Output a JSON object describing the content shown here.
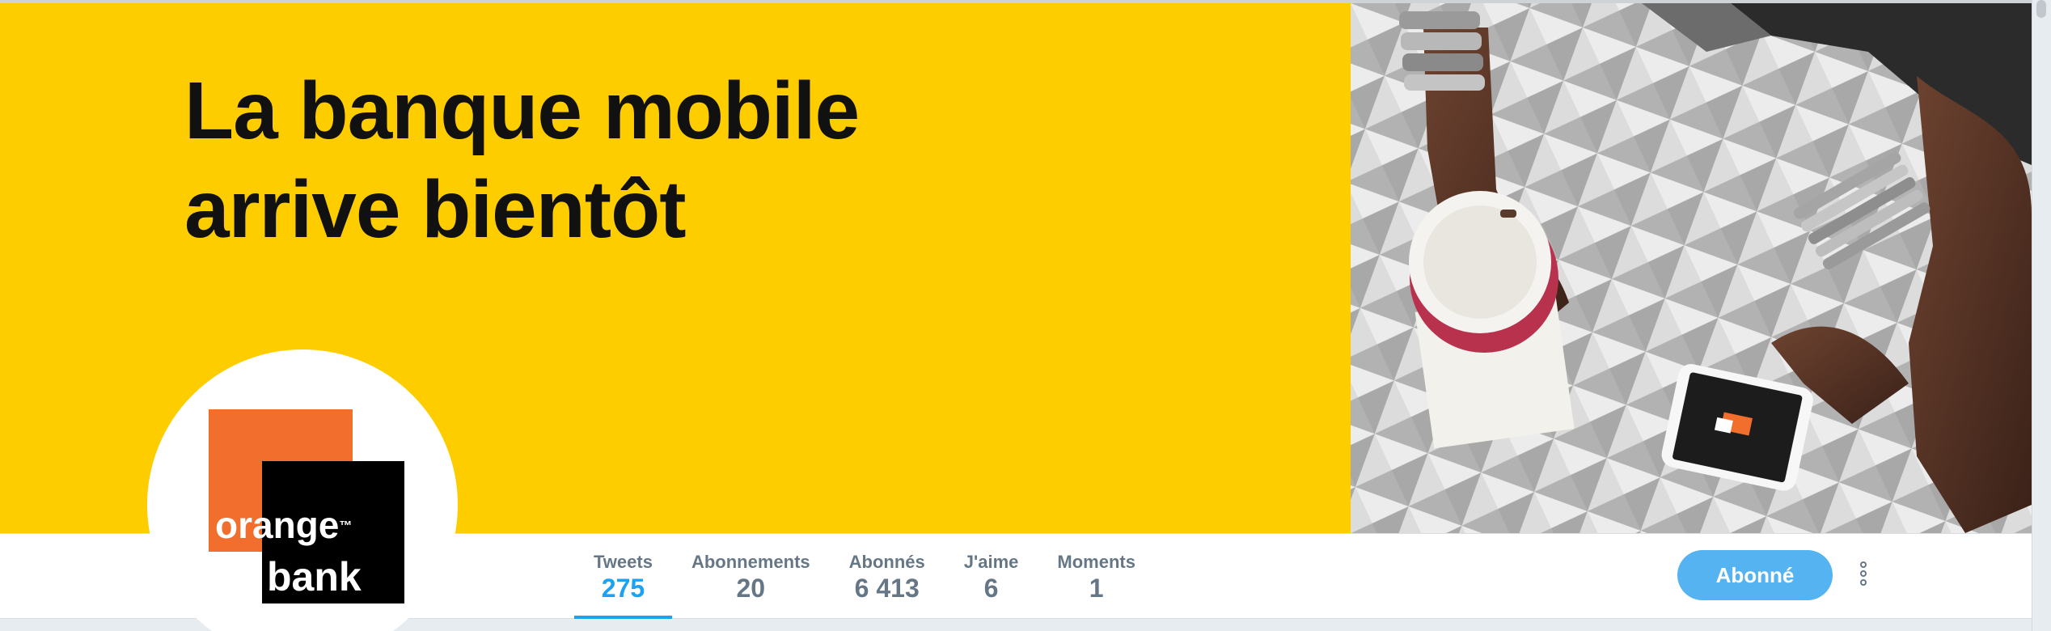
{
  "banner": {
    "headline_line1": "La banque mobile",
    "headline_line2": "arrive bientôt",
    "background_color": "#fecd00"
  },
  "avatar": {
    "logo_word_orange": "orange",
    "logo_tm": "™",
    "logo_word_bank": "bank",
    "brand_orange": "#f16e2c"
  },
  "stats": [
    {
      "label": "Tweets",
      "value": "275",
      "active": true
    },
    {
      "label": "Abonnements",
      "value": "20",
      "active": false
    },
    {
      "label": "Abonnés",
      "value": "6 413",
      "active": false
    },
    {
      "label": "J'aime",
      "value": "6",
      "active": false
    },
    {
      "label": "Moments",
      "value": "1",
      "active": false
    }
  ],
  "actions": {
    "follow_label": "Abonné",
    "more_icon": "vertical-ellipsis-icon",
    "accent_color": "#1da1f2"
  }
}
